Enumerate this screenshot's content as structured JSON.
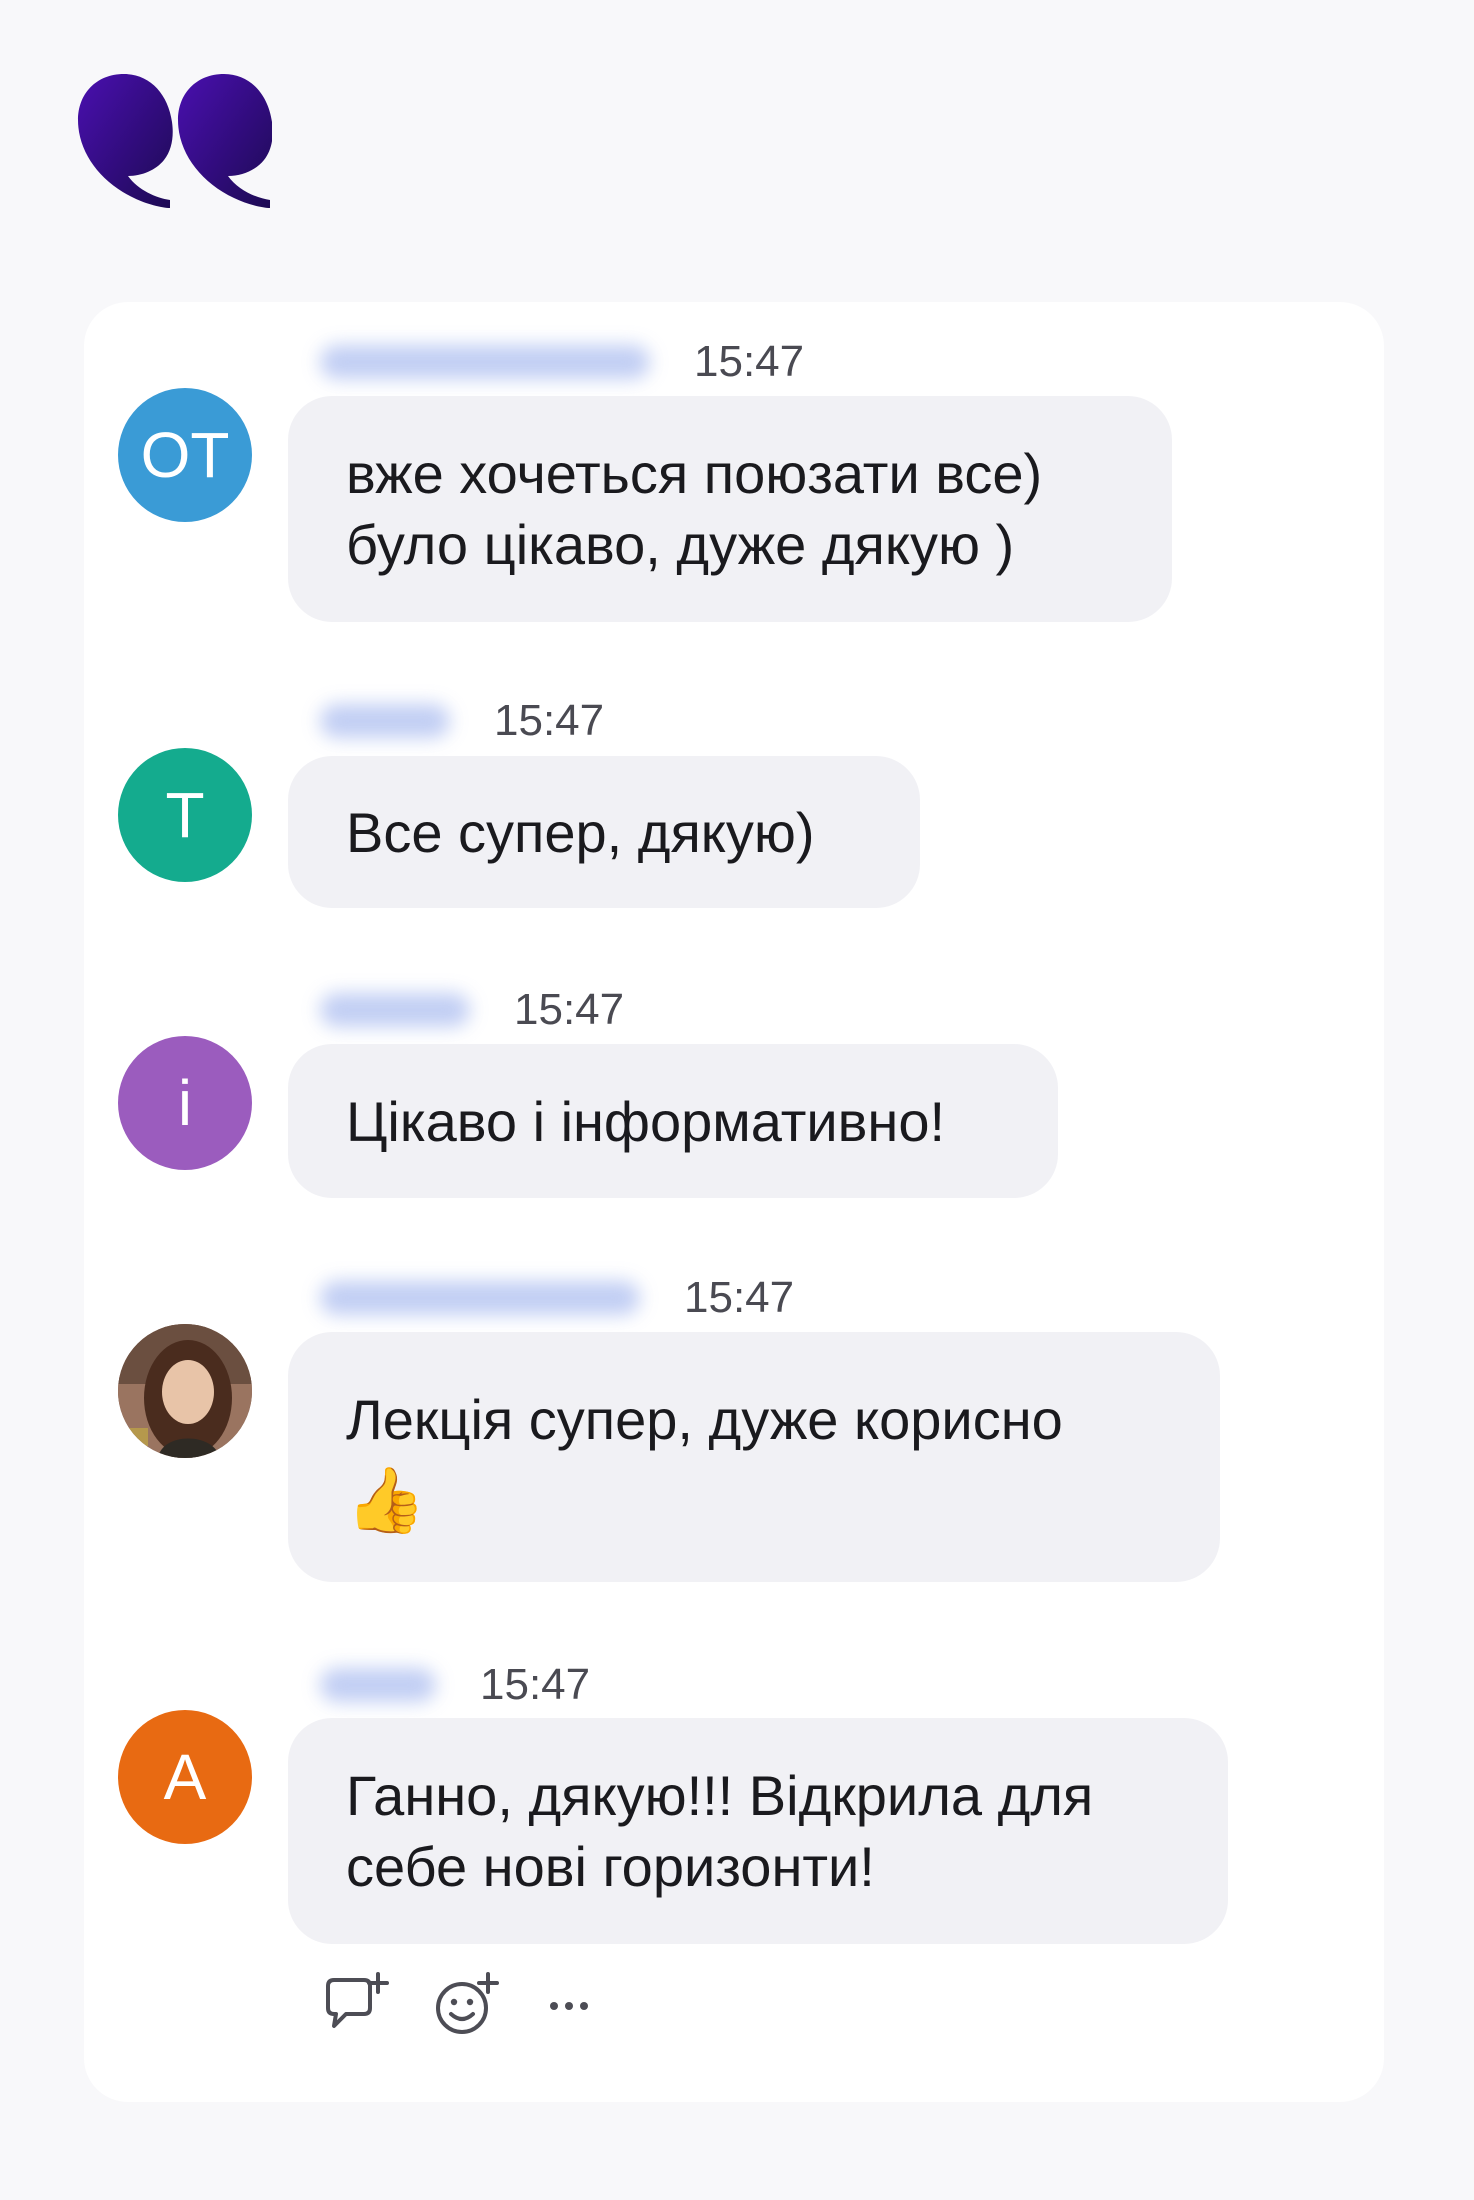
{
  "messages": [
    {
      "initials": "OT",
      "avatar_color": "#3a9bd6",
      "time": "15:47",
      "lines": [
        "вже хочеться поюзати все)",
        "було цікаво, дуже дякую )"
      ]
    },
    {
      "initials": "T",
      "avatar_color": "#14ab8e",
      "time": "15:47",
      "lines": [
        "Все супер, дякую)"
      ]
    },
    {
      "initials": "i",
      "avatar_color": "#9b5cbe",
      "time": "15:47",
      "lines": [
        "Цікаво і інформативно!"
      ]
    },
    {
      "initials": "",
      "avatar_color": "#7a5a48",
      "time": "15:47",
      "lines": [
        "Лекція супер, дуже корисно"
      ],
      "emoji": "👍"
    },
    {
      "initials": "A",
      "avatar_color": "#e86a12",
      "time": "15:47",
      "lines": [
        "Ганно, дякую!!! Відкрила для",
        "себе нові горизонти!"
      ]
    }
  ],
  "actions": [
    "reply-icon",
    "add-reaction-icon",
    "more-icon"
  ]
}
